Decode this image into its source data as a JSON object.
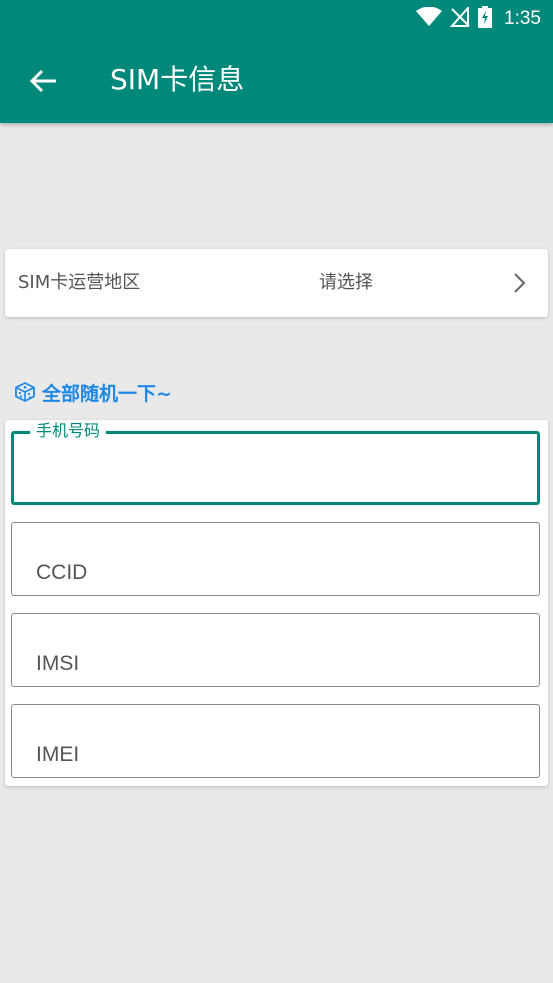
{
  "status_bar": {
    "time": "1:35",
    "icons": [
      "wifi-icon",
      "no-signal-icon",
      "battery-charging-icon"
    ]
  },
  "app_bar": {
    "title": "SIM卡信息",
    "back_icon": "arrow-left-icon"
  },
  "region_selector": {
    "label": "SIM卡运营地区",
    "value": "请选择",
    "chevron_icon": "chevron-right-icon"
  },
  "randomize": {
    "label": "全部随机一下~",
    "icon": "dice-icon"
  },
  "form": {
    "phone": {
      "label": "手机号码",
      "value": ""
    },
    "ccid": {
      "placeholder": "CCID",
      "value": ""
    },
    "imsi": {
      "placeholder": "IMSI",
      "value": ""
    },
    "imei": {
      "placeholder": "IMEI",
      "value": ""
    }
  },
  "colors": {
    "primary": "#00897b",
    "accent_link": "#1e88e5",
    "background": "#e9e9e9",
    "card": "#ffffff"
  }
}
